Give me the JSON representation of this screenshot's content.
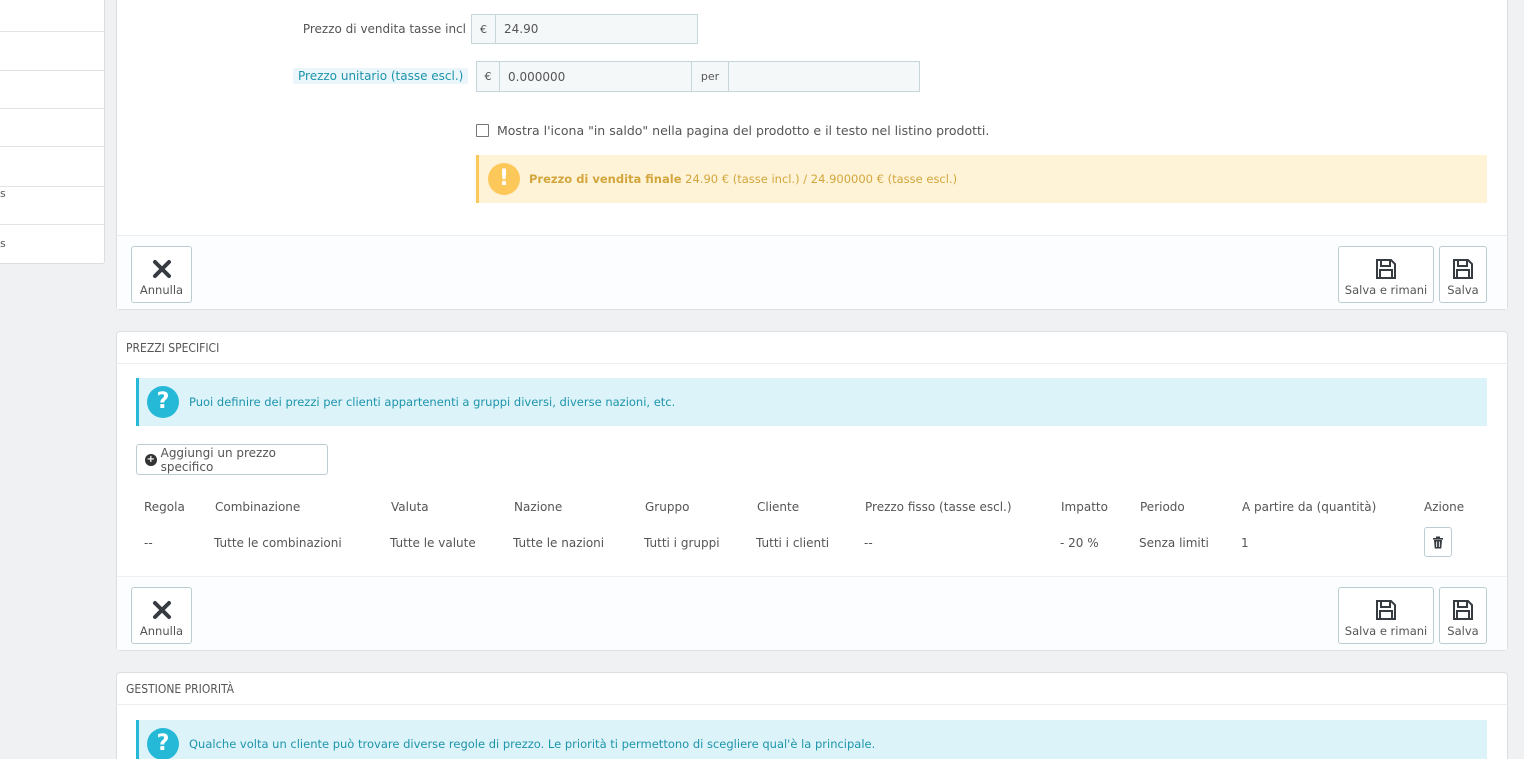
{
  "sidebar": {
    "items": [
      "",
      "",
      "",
      "",
      "",
      "s"
    ]
  },
  "pricing": {
    "sale_price_label": "Prezzo di vendita tasse incl",
    "sale_price_currency": "€",
    "sale_price_value": "24.90",
    "unit_price_label": "Prezzo unitario (tasse escl.)",
    "unit_price_currency": "€",
    "unit_price_value": "0.000000",
    "unit_per_label": "per",
    "unit_per_value": "",
    "on_sale_label": "Mostra l'icona \"in saldo\" nella pagina del prodotto e il testo nel listino prodotti.",
    "final_price_strong": "Prezzo di vendita finale",
    "final_price_text": " 24.90 € (tasse incl.) / 24.900000 € (tasse escl.)"
  },
  "footer": {
    "cancel_label": "Annulla",
    "save_stay_label": "Salva e rimani",
    "save_label": "Salva"
  },
  "specific_prices": {
    "title": "PREZZI SPECIFICI",
    "info": "Puoi definire dei prezzi per clienti appartenenti a gruppi diversi, diverse nazioni, etc.",
    "add_label": "Aggiungi un prezzo specifico",
    "columns": [
      "Regola",
      "Combinazione",
      "Valuta",
      "Nazione",
      "Gruppo",
      "Cliente",
      "Prezzo fisso (tasse escl.)",
      "Impatto",
      "Periodo",
      "A partire da (quantità)",
      "Azione"
    ],
    "rows": [
      [
        "--",
        "Tutte le combinazioni",
        "Tutte le valute",
        "Tutte le nazioni",
        "Tutti i gruppi",
        "Tutti i clienti",
        "--",
        "- 20 %",
        "Senza limiti",
        "1"
      ]
    ]
  },
  "priority": {
    "title": "GESTIONE PRIORITÀ",
    "info": "Qualche volta un cliente può trovare diverse regole di prezzo. Le priorità ti permettono di scegliere qual'è la principale."
  },
  "colors": {
    "info_accent": "#25b9d7",
    "warning_accent": "#fcc85a"
  }
}
